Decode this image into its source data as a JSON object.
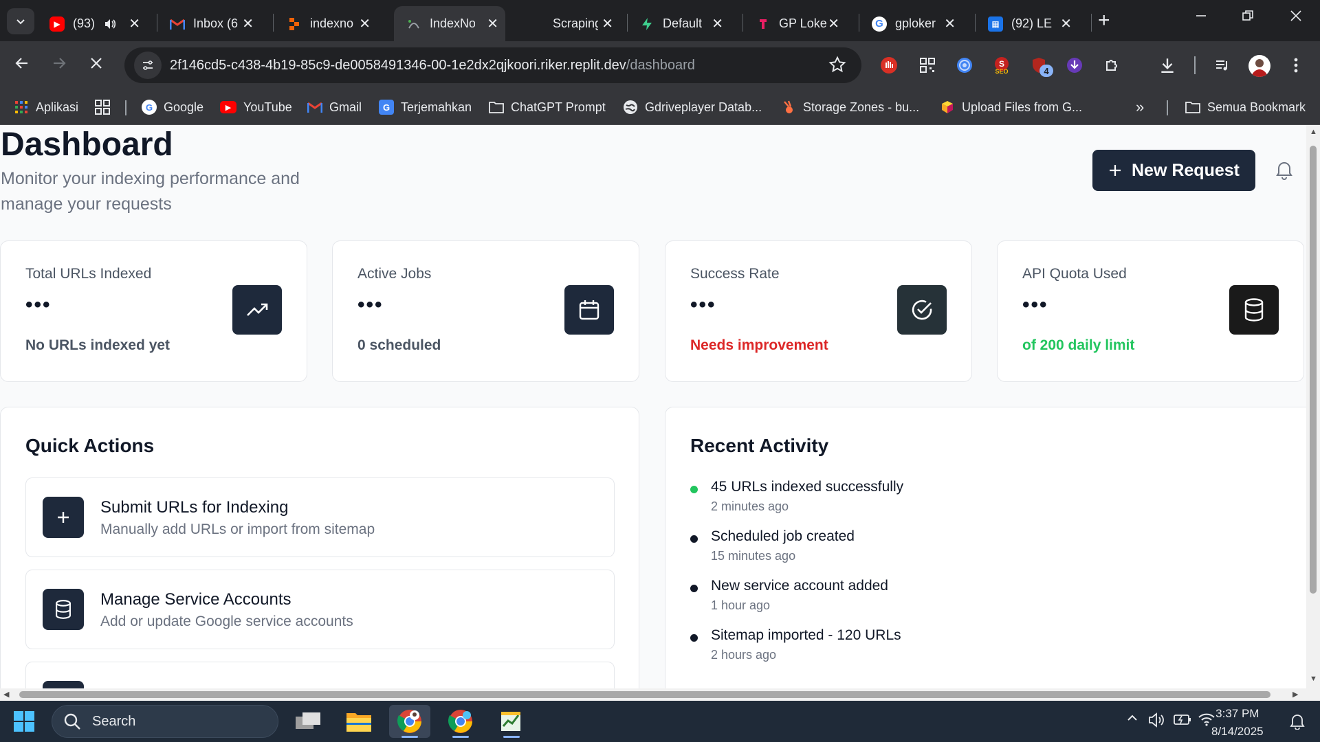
{
  "browser": {
    "tabs": [
      {
        "title": "(93)",
        "icon": "youtube-icon",
        "color": "#ff0000",
        "has_audio": true
      },
      {
        "title": "Inbox (6",
        "icon": "gmail-icon",
        "color": "#ea4335"
      },
      {
        "title": "indexno",
        "icon": "replit-icon",
        "color": "#f26207"
      },
      {
        "title": "IndexNo",
        "icon": "replit-icon",
        "color": "#9aa0a6",
        "active": true
      },
      {
        "title": "Scraping",
        "icon": "",
        "color": "#35363a"
      },
      {
        "title": "Default",
        "icon": "supabase-icon",
        "color": "#3ecf8e"
      },
      {
        "title": "GP Loke",
        "icon": "tab-icon",
        "color": "#e91e63"
      },
      {
        "title": "gploker",
        "icon": "google-icon",
        "color": "#4285f4"
      },
      {
        "title": "(92) LE",
        "icon": "app-icon",
        "color": "#1a73e8"
      }
    ],
    "url_host": "2f146cd5-c438-4b19-85c9-de0058491346-00-1e2dx2qjkoori.riker.replit.dev",
    "url_path": "/dashboard",
    "extension_badge": "4",
    "bookmarks": [
      {
        "label": "Aplikasi",
        "icon": "apps-grid-icon"
      },
      {
        "label": "Google",
        "icon": "google-icon"
      },
      {
        "label": "YouTube",
        "icon": "youtube-icon"
      },
      {
        "label": "Gmail",
        "icon": "gmail-icon"
      },
      {
        "label": "Terjemahkan",
        "icon": "translate-icon"
      },
      {
        "label": "ChatGPT Prompt",
        "icon": "folder-icon"
      },
      {
        "label": "Gdriveplayer Datab...",
        "icon": "globe-icon"
      },
      {
        "label": "Storage Zones - bu...",
        "icon": "bunny-icon"
      },
      {
        "label": "Upload Files from G...",
        "icon": "cube-icon"
      }
    ],
    "all_bookmarks": "Semua Bookmark"
  },
  "page": {
    "title": "Dashboard",
    "subtitle": "Monitor your indexing performance and manage your requests",
    "new_request_label": "New Request",
    "stats": [
      {
        "label": "Total URLs Indexed",
        "value": "•••",
        "sub": "No URLs indexed yet",
        "sub_color": "#4b5563",
        "icon": "trending-up-icon"
      },
      {
        "label": "Active Jobs",
        "value": "•••",
        "sub": "0 scheduled",
        "sub_color": "#4b5563",
        "icon": "calendar-icon"
      },
      {
        "label": "Success Rate",
        "value": "•••",
        "sub": "Needs improvement",
        "sub_color": "#dc2626",
        "icon": "check-circle-icon"
      },
      {
        "label": "API Quota Used",
        "value": "•••",
        "sub": "of 200 daily limit",
        "sub_color": "#22c55e",
        "icon": "database-icon"
      }
    ],
    "quick_actions": {
      "title": "Quick Actions",
      "items": [
        {
          "title": "Submit URLs for Indexing",
          "desc": "Manually add URLs or import from sitemap",
          "icon": "plus-icon"
        },
        {
          "title": "Manage Service Accounts",
          "desc": "Add or update Google service accounts",
          "icon": "database-icon"
        },
        {
          "title": "",
          "desc": "",
          "icon": "list-icon"
        }
      ]
    },
    "recent_activity": {
      "title": "Recent Activity",
      "items": [
        {
          "text": "45 URLs indexed successfully",
          "time": "2 minutes ago",
          "dot_color": "#22c55e"
        },
        {
          "text": "Scheduled job created",
          "time": "15 minutes ago",
          "dot_color": "#111827"
        },
        {
          "text": "New service account added",
          "time": "1 hour ago",
          "dot_color": "#111827"
        },
        {
          "text": "Sitemap imported - 120 URLs",
          "time": "2 hours ago",
          "dot_color": "#111827"
        }
      ]
    }
  },
  "taskbar": {
    "search_placeholder": "Search",
    "time": "3:37 PM",
    "date": "8/14/2025"
  }
}
